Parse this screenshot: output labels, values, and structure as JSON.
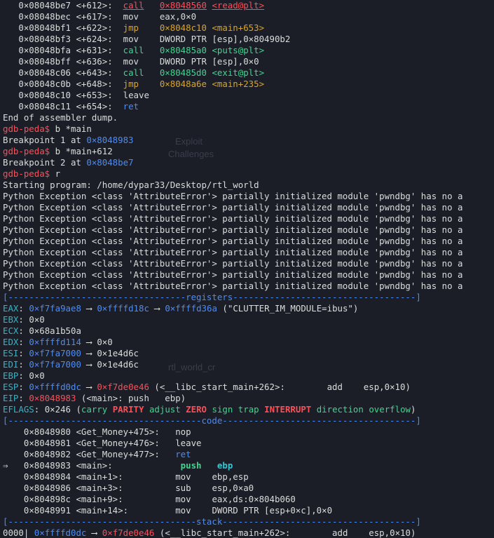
{
  "disasm": [
    {
      "addr": "0×08048be7",
      "off": "<+612>:",
      "mnem": "call",
      "op": "0×8048560",
      "sym": "<read@plt>"
    },
    {
      "addr": "0×08048bec",
      "off": "<+617>:",
      "mnem": "mov",
      "op": "eax,0×0",
      "sym": ""
    },
    {
      "addr": "0×08048bf1",
      "off": "<+622>:",
      "mnem": "jmp",
      "op": "0×8048c10",
      "sym": "<main+653>"
    },
    {
      "addr": "0×08048bf3",
      "off": "<+624>:",
      "mnem": "mov",
      "op": "DWORD PTR [esp],0×80490b2",
      "sym": ""
    },
    {
      "addr": "0×08048bfa",
      "off": "<+631>:",
      "mnem": "call",
      "op": "0×80485a0",
      "sym": "<puts@plt>"
    },
    {
      "addr": "0×08048bff",
      "off": "<+636>:",
      "mnem": "mov",
      "op": "DWORD PTR [esp],0×0",
      "sym": ""
    },
    {
      "addr": "0×08048c06",
      "off": "<+643>:",
      "mnem": "call",
      "op": "0×80485d0",
      "sym": "<exit@plt>"
    },
    {
      "addr": "0×08048c0b",
      "off": "<+648>:",
      "mnem": "jmp",
      "op": "0×8048a6e",
      "sym": "<main+235>"
    },
    {
      "addr": "0×08048c10",
      "off": "<+653>:",
      "mnem": "leave",
      "op": "",
      "sym": ""
    },
    {
      "addr": "0×08048c11",
      "off": "<+654>:",
      "mnem": "ret",
      "op": "",
      "sym": ""
    }
  ],
  "end_dump": "End of assembler dump.",
  "prompt": "gdb-peda$",
  "cmd1": " b *main",
  "bp1_prefix": "Breakpoint 1 at ",
  "bp1_addr": "0×8048983",
  "cmd2": " b *main+612",
  "bp2_prefix": "Breakpoint 2 at ",
  "bp2_addr": "0×8048be7",
  "cmd3": " r",
  "starting": "Starting program: /home/dypar33/Desktop/rtl_world",
  "exception_line": "Python Exception <class 'AttributeError'> partially initialized module 'pwndbg' has no a",
  "exception_count": 9,
  "bar_registers": "[----------------------------------registers-----------------------------------]",
  "registers": {
    "eax": {
      "name": "EAX",
      "v1": "0×f7fa9ae8",
      "v2": "0×ffffd18c",
      "v3": "0×ffffd36a",
      "str": "(\"CLUTTER_IM_MODULE=ibus\")"
    },
    "ebx": {
      "name": "EBX",
      "v": "0×0"
    },
    "ecx": {
      "name": "ECX",
      "v": "0×68a1b50a"
    },
    "edx": {
      "name": "EDX",
      "v1": "0×ffffd114",
      "v2": "0×0"
    },
    "esi": {
      "name": "ESI",
      "v1": "0×f7fa7000",
      "v2": "0×1e4d6c"
    },
    "edi": {
      "name": "EDI",
      "v1": "0×f7fa7000",
      "v2": "0×1e4d6c"
    },
    "ebp": {
      "name": "EBP",
      "v": "0×0"
    },
    "esp": {
      "name": "ESP",
      "v1": "0×ffffd0dc",
      "v2": "0×f7de0e46",
      "tail": "(<__libc_start_main+262>:        add    esp,0×10)"
    },
    "eip": {
      "name": "EIP",
      "v1": "0×8048983",
      "tail": "(<main>: push   ebp)"
    },
    "eflags": {
      "name": "EFLAGS",
      "v": "0×246",
      "f_carry": "carry",
      "f_parity": "PARITY",
      "f_adjust": "adjust",
      "f_zero": "ZERO",
      "f_sign": "sign",
      "f_trap": "trap",
      "f_interrupt": "INTERRUPT",
      "f_direction": "direction",
      "f_overflow": "overflow"
    }
  },
  "arrow": "⟶",
  "bar_code": "[-------------------------------------code-------------------------------------]",
  "code": [
    {
      "marker": "   ",
      "addr": "0×8048980",
      "sym": "<Get_Money+475>:",
      "mnem": "nop",
      "op": ""
    },
    {
      "marker": "   ",
      "addr": "0×8048981",
      "sym": "<Get_Money+476>:",
      "mnem": "leave",
      "op": ""
    },
    {
      "marker": "   ",
      "addr": "0×8048982",
      "sym": "<Get_Money+477>:",
      "mnem": "ret",
      "op": ""
    },
    {
      "marker": "⇒  ",
      "addr": "0×8048983",
      "sym": "<main>:",
      "mnem": "push",
      "op": "ebp"
    },
    {
      "marker": "   ",
      "addr": "0×8048984",
      "sym": "<main+1>:",
      "mnem": "mov",
      "op": "ebp,esp"
    },
    {
      "marker": "   ",
      "addr": "0×8048986",
      "sym": "<main+3>:",
      "mnem": "sub",
      "op": "esp,0×a0"
    },
    {
      "marker": "   ",
      "addr": "0×804898c",
      "sym": "<main+9>:",
      "mnem": "mov",
      "op": "eax,ds:0×804b060"
    },
    {
      "marker": "   ",
      "addr": "0×8048991",
      "sym": "<main+14>:",
      "mnem": "mov",
      "op": "DWORD PTR [esp+0×c],0×0"
    }
  ],
  "bar_stack": "[------------------------------------stack-------------------------------------]",
  "stack0": {
    "idx": "0000|",
    "v1": "0×ffffd0dc",
    "v2": "0×f7de0e46",
    "tail": "(<__libc_start_main+262>:        add    esp,0×10)"
  },
  "ghost": {
    "a": "Exploit",
    "b": "Challenges",
    "c": "rtl_world_cr"
  }
}
